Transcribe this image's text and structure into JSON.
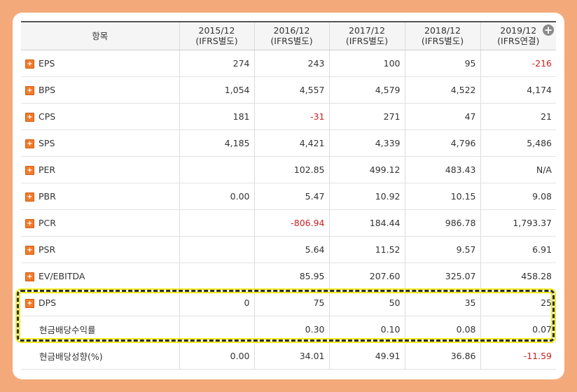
{
  "header": {
    "item_label": "항목",
    "columns": [
      {
        "year": "2015/12",
        "basis": "(IFRS별도)"
      },
      {
        "year": "2016/12",
        "basis": "(IFRS별도)"
      },
      {
        "year": "2017/12",
        "basis": "(IFRS별도)"
      },
      {
        "year": "2018/12",
        "basis": "(IFRS별도)"
      },
      {
        "year": "2019/12",
        "basis": "(IFRS연결)"
      }
    ],
    "expand_icon": "plus-circle-icon"
  },
  "rows": [
    {
      "label": "EPS",
      "expandable": true,
      "v": [
        "274",
        "243",
        "100",
        "95",
        "-216"
      ]
    },
    {
      "label": "BPS",
      "expandable": true,
      "v": [
        "1,054",
        "4,557",
        "4,579",
        "4,522",
        "4,174"
      ]
    },
    {
      "label": "CPS",
      "expandable": true,
      "v": [
        "181",
        "-31",
        "271",
        "47",
        "21"
      ]
    },
    {
      "label": "SPS",
      "expandable": true,
      "v": [
        "4,185",
        "4,421",
        "4,339",
        "4,796",
        "5,486"
      ]
    },
    {
      "label": "PER",
      "expandable": true,
      "v": [
        "",
        "102.85",
        "499.12",
        "483.43",
        "N/A"
      ]
    },
    {
      "label": "PBR",
      "expandable": true,
      "v": [
        "0.00",
        "5.47",
        "10.92",
        "10.15",
        "9.08"
      ]
    },
    {
      "label": "PCR",
      "expandable": true,
      "v": [
        "",
        "-806.94",
        "184.44",
        "986.78",
        "1,793.37"
      ]
    },
    {
      "label": "PSR",
      "expandable": true,
      "v": [
        "",
        "5.64",
        "11.52",
        "9.57",
        "6.91"
      ]
    },
    {
      "label": "EV/EBITDA",
      "expandable": true,
      "v": [
        "",
        "85.95",
        "207.60",
        "325.07",
        "458.28"
      ]
    },
    {
      "label": "DPS",
      "expandable": true,
      "v": [
        "0",
        "75",
        "50",
        "35",
        "25"
      ]
    },
    {
      "label": "현금배당수익률",
      "expandable": false,
      "v": [
        "",
        "0.30",
        "0.10",
        "0.08",
        "0.07"
      ]
    },
    {
      "label": "현금배당성향(%)",
      "expandable": false,
      "v": [
        "0.00",
        "34.01",
        "49.91",
        "36.86",
        "-11.59"
      ]
    }
  ],
  "colors": {
    "negative": "#cc1f1f",
    "highlight_dash": "#2b2b2b",
    "highlight_glow": "#f0ec1e",
    "frame_bg": "#f4a97a",
    "expand_box": "#f07a2a"
  }
}
